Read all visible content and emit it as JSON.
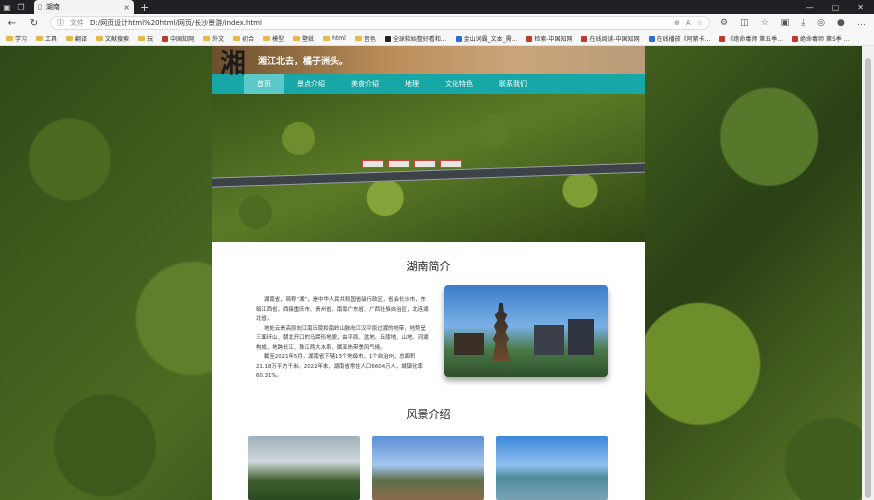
{
  "browser": {
    "tab_title": "湖南",
    "address": {
      "file_label": "文件",
      "url": "D:/网页设计html%20html/网页/长沙景游/index.html"
    },
    "bookmarks": [
      {
        "label": "学习",
        "type": "folder"
      },
      {
        "label": "工具",
        "type": "folder"
      },
      {
        "label": "翻译",
        "type": "folder"
      },
      {
        "label": "文献搜索",
        "type": "folder"
      },
      {
        "label": "玩",
        "type": "folder"
      },
      {
        "label": "中国知网",
        "type": "site",
        "color": "#c0392b"
      },
      {
        "label": "外文",
        "type": "folder"
      },
      {
        "label": "初合",
        "type": "folder"
      },
      {
        "label": "模型",
        "type": "folder"
      },
      {
        "label": "壁纸",
        "type": "folder"
      },
      {
        "label": "html",
        "type": "folder"
      },
      {
        "label": "音色",
        "type": "folder"
      },
      {
        "label": "全球软始整好看和...",
        "type": "site",
        "color": "#222222"
      },
      {
        "label": "金山词霸_文本_需...",
        "type": "site",
        "color": "#2a6fd6"
      },
      {
        "label": "检索-中国知网",
        "type": "site",
        "color": "#c0392b"
      },
      {
        "label": "在线阅读-中国知网",
        "type": "site",
        "color": "#c0392b"
      },
      {
        "label": "在线播放《阿紫卡...",
        "type": "site",
        "color": "#2a6fd6"
      },
      {
        "label": "《绝命毒师 第五季...",
        "type": "site",
        "color": "#c0392b"
      },
      {
        "label": "绝命毒师 第5季 ...",
        "type": "site",
        "color": "#c0392b"
      }
    ]
  },
  "site": {
    "logo_char": "湘",
    "slogan": "湘江北去，橘子洲头。",
    "nav": [
      {
        "label": "首页",
        "active": true
      },
      {
        "label": "景点介绍",
        "active": false
      },
      {
        "label": "美食介绍",
        "active": false
      },
      {
        "label": "地理",
        "active": false
      },
      {
        "label": "文化特色",
        "active": false
      },
      {
        "label": "联系我们",
        "active": false
      }
    ],
    "intro": {
      "title": "湖南简介",
      "paragraphs": [
        "湖南省，简称“湘”，是中华人民共和国省级行政区，省会长沙市，东临江西省，西接重庆市、贵州省，南靠广东省、广西壮族自治区，北连湖北省。",
        "地处云贵高原向江南丘陵和南岭山脉向江汉平原过渡的地带，地势呈三面环山、朝北开口的马蹄形地貌，由平原、盆地、丘陵地、山地、河湖构成，地跨长江、珠江两大水系，属亚热带季风气候。",
        "截至2021年5月，湖南省下辖13个地级市，1个自治州，总面积21.18万平方千米。2022年末，湖南省常住人口6604万人，城镇化率60.31%。"
      ]
    },
    "scenic": {
      "title": "风景介绍"
    }
  }
}
